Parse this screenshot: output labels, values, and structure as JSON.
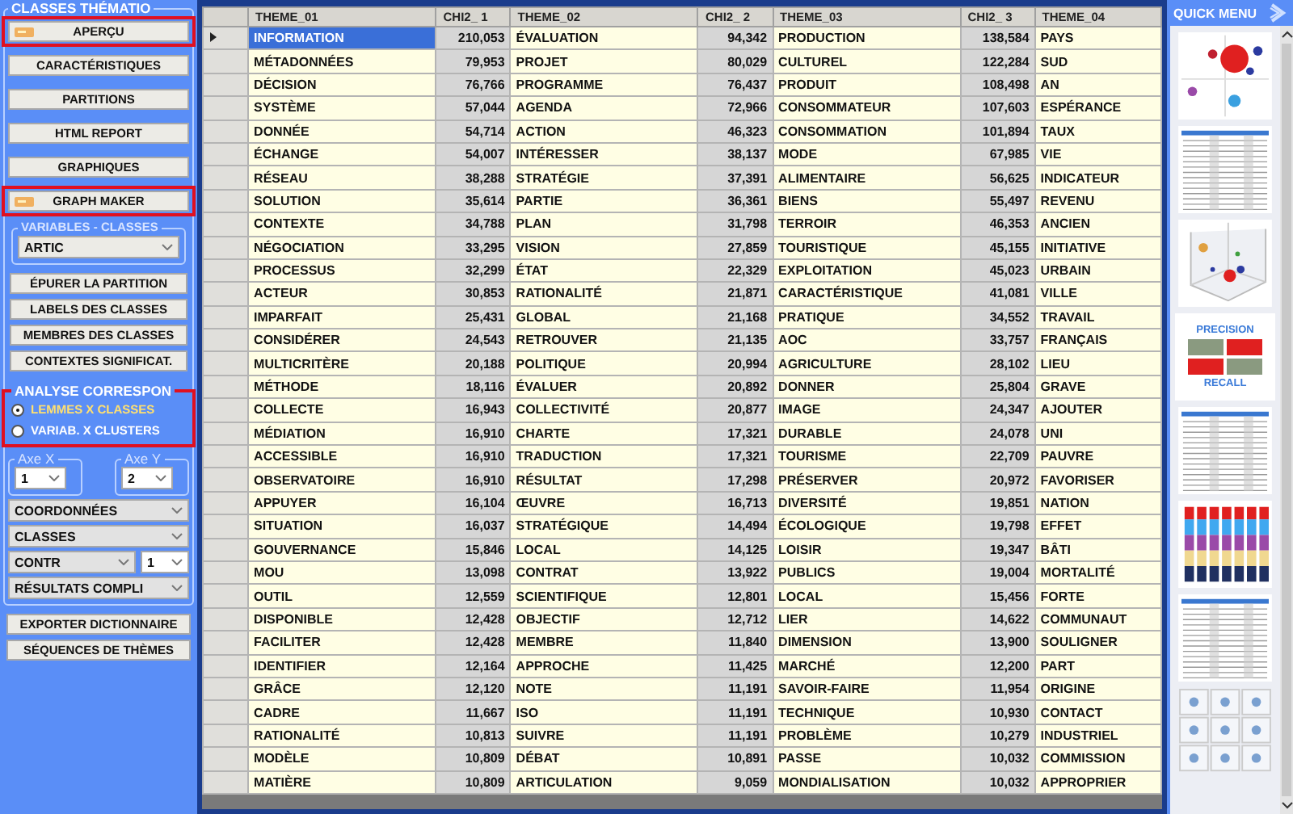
{
  "left_panel": {
    "group_title": "CLASSES THÉMATIO",
    "buttons_top": [
      {
        "label": "APERÇU",
        "highlighted": true,
        "has_icon": true
      },
      {
        "label": "CARACTÉRISTIQUES",
        "highlighted": false,
        "has_icon": false
      },
      {
        "label": "PARTITIONS",
        "highlighted": false,
        "has_icon": false
      },
      {
        "label": "HTML REPORT",
        "highlighted": false,
        "has_icon": false
      },
      {
        "label": "GRAPHIQUES",
        "highlighted": false,
        "has_icon": false
      },
      {
        "label": "GRAPH MAKER",
        "highlighted": true,
        "has_icon": true
      }
    ],
    "variables_group": {
      "title": "VARIABLES - CLASSES",
      "value": "ARTIC"
    },
    "buttons_mid": [
      "ÉPURER LA PARTITION",
      "LABELS DES CLASSES",
      "MEMBRES DES CLASSES",
      "CONTEXTES SIGNIFICAT."
    ],
    "analysis_group": {
      "title": "ANALYSE CORRESPON",
      "highlighted": true,
      "options": [
        {
          "label": "LEMMES X CLASSES",
          "selected": true
        },
        {
          "label": "VARIAB. X CLUSTERS",
          "selected": false
        }
      ]
    },
    "axes": [
      {
        "title": "Axe X",
        "value": "1"
      },
      {
        "title": "Axe Y",
        "value": "2"
      }
    ],
    "dropdowns": [
      "COORDONNÉES",
      "CLASSES"
    ],
    "contr": {
      "value": "CONTR",
      "number": "1"
    },
    "results": "RÉSULTATS COMPLI",
    "buttons_bottom": [
      "EXPORTER DICTIONNAIRE",
      "SÉQUENCES DE THÈMES"
    ]
  },
  "table": {
    "columns": [
      "THEME_01",
      "CHI2_ 1",
      "THEME_02",
      "CHI2_ 2",
      "THEME_03",
      "CHI2_ 3",
      "THEME_04"
    ],
    "rows": [
      {
        "selected": true,
        "cells": [
          "INFORMATION",
          "210,053",
          "ÉVALUATION",
          "94,342",
          "PRODUCTION",
          "138,584",
          "PAYS"
        ]
      },
      {
        "selected": false,
        "cells": [
          "MÉTADONNÉES",
          "79,953",
          "PROJET",
          "80,029",
          "CULTUREL",
          "122,284",
          "SUD"
        ]
      },
      {
        "selected": false,
        "cells": [
          "DÉCISION",
          "76,766",
          "PROGRAMME",
          "76,437",
          "PRODUIT",
          "108,498",
          "AN"
        ]
      },
      {
        "selected": false,
        "cells": [
          "SYSTÈME",
          "57,044",
          "AGENDA",
          "72,966",
          "CONSOMMATEUR",
          "107,603",
          "ESPÉRANCE"
        ]
      },
      {
        "selected": false,
        "cells": [
          "DONNÉE",
          "54,714",
          "ACTION",
          "46,323",
          "CONSOMMATION",
          "101,894",
          "TAUX"
        ]
      },
      {
        "selected": false,
        "cells": [
          "ÉCHANGE",
          "54,007",
          "INTÉRESSER",
          "38,137",
          "MODE",
          "67,985",
          "VIE"
        ]
      },
      {
        "selected": false,
        "cells": [
          "RÉSEAU",
          "38,288",
          "STRATÉGIE",
          "37,391",
          "ALIMENTAIRE",
          "56,625",
          "INDICATEUR"
        ]
      },
      {
        "selected": false,
        "cells": [
          "SOLUTION",
          "35,614",
          "PARTIE",
          "36,361",
          "BIENS",
          "55,497",
          "REVENU"
        ]
      },
      {
        "selected": false,
        "cells": [
          "CONTEXTE",
          "34,788",
          "PLAN",
          "31,798",
          "TERROIR",
          "46,353",
          "ANCIEN"
        ]
      },
      {
        "selected": false,
        "cells": [
          "NÉGOCIATION",
          "33,295",
          "VISION",
          "27,859",
          "TOURISTIQUE",
          "45,155",
          "INITIATIVE"
        ]
      },
      {
        "selected": false,
        "cells": [
          "PROCESSUS",
          "32,299",
          "ÉTAT",
          "22,329",
          "EXPLOITATION",
          "45,023",
          "URBAIN"
        ]
      },
      {
        "selected": false,
        "cells": [
          "ACTEUR",
          "30,853",
          "RATIONALITÉ",
          "21,871",
          "CARACTÉRISTIQUE",
          "41,081",
          "VILLE"
        ]
      },
      {
        "selected": false,
        "cells": [
          "IMPARFAIT",
          "25,431",
          "GLOBAL",
          "21,168",
          "PRATIQUE",
          "34,552",
          "TRAVAIL"
        ]
      },
      {
        "selected": false,
        "cells": [
          "CONSIDÉRER",
          "24,543",
          "RETROUVER",
          "21,135",
          "AOC",
          "33,757",
          "FRANÇAIS"
        ]
      },
      {
        "selected": false,
        "cells": [
          "MULTICRITÈRE",
          "20,188",
          "POLITIQUE",
          "20,994",
          "AGRICULTURE",
          "28,102",
          "LIEU"
        ]
      },
      {
        "selected": false,
        "cells": [
          "MÉTHODE",
          "18,116",
          "ÉVALUER",
          "20,892",
          "DONNER",
          "25,804",
          "GRAVE"
        ]
      },
      {
        "selected": false,
        "cells": [
          "COLLECTE",
          "16,943",
          "COLLECTIVITÉ",
          "20,877",
          "IMAGE",
          "24,347",
          "AJOUTER"
        ]
      },
      {
        "selected": false,
        "cells": [
          "MÉDIATION",
          "16,910",
          "CHARTE",
          "17,321",
          "DURABLE",
          "24,078",
          "UNI"
        ]
      },
      {
        "selected": false,
        "cells": [
          "ACCESSIBLE",
          "16,910",
          "TRADUCTION",
          "17,321",
          "TOURISME",
          "22,709",
          "PAUVRE"
        ]
      },
      {
        "selected": false,
        "cells": [
          "OBSERVATOIRE",
          "16,910",
          "RÉSULTAT",
          "17,298",
          "PRÉSERVER",
          "20,972",
          "FAVORISER"
        ]
      },
      {
        "selected": false,
        "cells": [
          "APPUYER",
          "16,104",
          "ŒUVRE",
          "16,713",
          "DIVERSITÉ",
          "19,851",
          "NATION"
        ]
      },
      {
        "selected": false,
        "cells": [
          "SITUATION",
          "16,037",
          "STRATÉGIQUE",
          "14,494",
          "ÉCOLOGIQUE",
          "19,798",
          "EFFET"
        ]
      },
      {
        "selected": false,
        "cells": [
          "GOUVERNANCE",
          "15,846",
          "LOCAL",
          "14,125",
          "LOISIR",
          "19,347",
          "BÂTI"
        ]
      },
      {
        "selected": false,
        "cells": [
          "MOU",
          "13,098",
          "CONTRAT",
          "13,922",
          "PUBLICS",
          "19,004",
          "MORTALITÉ"
        ]
      },
      {
        "selected": false,
        "cells": [
          "OUTIL",
          "12,559",
          "SCIENTIFIQUE",
          "12,801",
          "LOCAL",
          "15,456",
          "FORTE"
        ]
      },
      {
        "selected": false,
        "cells": [
          "DISPONIBLE",
          "12,428",
          "OBJECTIF",
          "12,712",
          "LIER",
          "14,622",
          "COMMUNAUT"
        ]
      },
      {
        "selected": false,
        "cells": [
          "FACILITER",
          "12,428",
          "MEMBRE",
          "11,840",
          "DIMENSION",
          "13,900",
          "SOULIGNER"
        ]
      },
      {
        "selected": false,
        "cells": [
          "IDENTIFIER",
          "12,164",
          "APPROCHE",
          "11,425",
          "MARCHÉ",
          "12,200",
          "PART"
        ]
      },
      {
        "selected": false,
        "cells": [
          "GRÂCE",
          "12,120",
          "NOTE",
          "11,191",
          "SAVOIR-FAIRE",
          "11,954",
          "ORIGINE"
        ]
      },
      {
        "selected": false,
        "cells": [
          "CADRE",
          "11,667",
          "ISO",
          "11,191",
          "TECHNIQUE",
          "10,930",
          "CONTACT"
        ]
      },
      {
        "selected": false,
        "cells": [
          "RATIONALITÉ",
          "10,813",
          "SUIVRE",
          "11,191",
          "PROBLÈME",
          "10,279",
          "INDUSTRIEL"
        ]
      },
      {
        "selected": false,
        "cells": [
          "MODÈLE",
          "10,809",
          "DÉBAT",
          "10,891",
          "PASSE",
          "10,032",
          "COMMISSION"
        ]
      },
      {
        "selected": false,
        "cells": [
          "MATIÈRE",
          "10,809",
          "ARTICULATION",
          "9,059",
          "MONDIALISATION",
          "10,032",
          "APPROPRIER"
        ]
      }
    ]
  },
  "quick_menu": {
    "title": "QUICK MENU",
    "items": [
      {
        "kind": "bubble"
      },
      {
        "kind": "table"
      },
      {
        "kind": "scatter3d"
      },
      {
        "kind": "precision",
        "labels": [
          "PRECISION",
          "RECALL"
        ]
      },
      {
        "kind": "table"
      },
      {
        "kind": "stacked"
      },
      {
        "kind": "table"
      },
      {
        "kind": "grid"
      }
    ]
  }
}
